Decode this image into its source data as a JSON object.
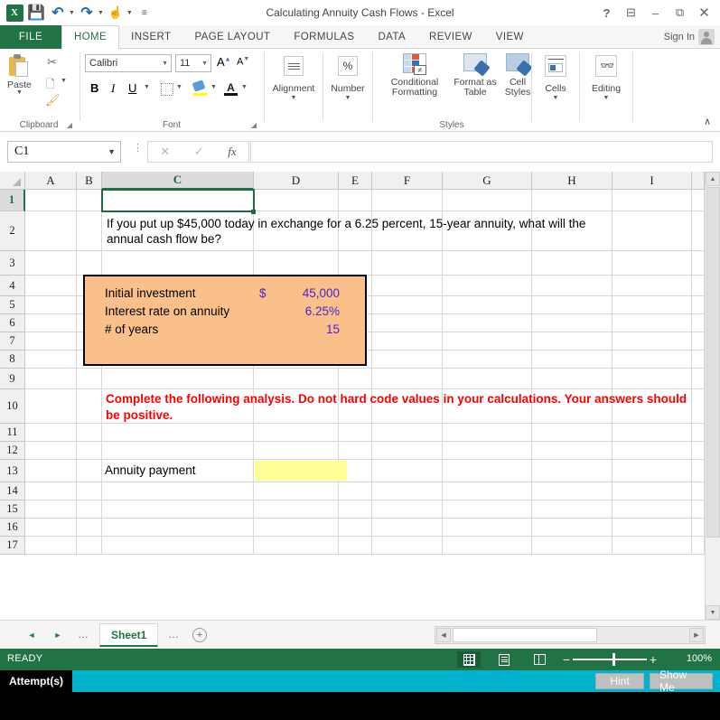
{
  "window": {
    "title": "Calculating Annuity Cash Flows - Excel",
    "controls": [
      "?",
      "ribbon-display",
      "minimize",
      "restore",
      "close"
    ],
    "sign_in": "Sign In"
  },
  "quick_access": [
    {
      "name": "excel-logo",
      "glyph": "X"
    },
    {
      "name": "save-icon",
      "glyph": "❐"
    },
    {
      "name": "undo-icon",
      "glyph": "↶"
    },
    {
      "name": "redo-icon",
      "glyph": "↷"
    },
    {
      "name": "touch-mode-icon",
      "glyph": "☝"
    },
    {
      "name": "customize-qat-icon",
      "glyph": "≡"
    }
  ],
  "ribbon": {
    "tabs": [
      {
        "label": "FILE",
        "active": false
      },
      {
        "label": "HOME",
        "active": true
      },
      {
        "label": "INSERT",
        "active": false
      },
      {
        "label": "PAGE LAYOUT",
        "active": false
      },
      {
        "label": "FORMULAS",
        "active": false
      },
      {
        "label": "DATA",
        "active": false
      },
      {
        "label": "REVIEW",
        "active": false
      },
      {
        "label": "VIEW",
        "active": false
      }
    ],
    "groups": {
      "clipboard": {
        "label": "Clipboard",
        "paste": "Paste",
        "cut": "Cut",
        "copy": "Copy",
        "format_painter": "Format Painter"
      },
      "font": {
        "label": "Font",
        "font_name": "Calibri",
        "font_size": "11",
        "grow": "A",
        "shrink": "A",
        "bold": "B",
        "italic": "I",
        "underline": "U",
        "borders": "Borders",
        "fill_color": "Fill Color",
        "font_color": "A"
      },
      "alignment": {
        "label": "Alignment"
      },
      "number": {
        "label": "Number",
        "glyph": "%"
      },
      "styles": {
        "label": "Styles",
        "conditional_formatting": "Conditional Formatting",
        "format_as_table": "Format as Table",
        "cell_styles": "Cell Styles"
      },
      "cells": {
        "label": "Cells"
      },
      "editing": {
        "label": "Editing"
      },
      "collapse": "∧"
    }
  },
  "formula_bar": {
    "name_box": "C1",
    "cancel": "✕",
    "enter": "✓",
    "insert_function": "fx",
    "formula_value": ""
  },
  "grid": {
    "columns": [
      "A",
      "B",
      "C",
      "D",
      "E",
      "F",
      "G",
      "H",
      "I"
    ],
    "selected_column": "C",
    "rows": [
      "1",
      "2",
      "3",
      "4",
      "5",
      "6",
      "7",
      "8",
      "9",
      "10",
      "11",
      "12",
      "13",
      "14",
      "15",
      "16",
      "17"
    ],
    "selected_row": "1",
    "selected_cell": "C1",
    "content": {
      "question": "If you put up $45,000 today in exchange for a 6.25 percent, 15-year annuity, what will the\nannual cash flow be?",
      "input_box": {
        "rows": [
          {
            "label": "Initial investment",
            "currency": "$",
            "value": "45,000"
          },
          {
            "label": "Interest rate on annuity",
            "currency": "",
            "value": "6.25%"
          },
          {
            "label": "# of years",
            "currency": "",
            "value": "15"
          }
        ]
      },
      "instruction": "Complete the following analysis. Do not hard code values in your calculations. Your\nanswers should be positive.",
      "answer_label": "Annuity payment",
      "answer_value": ""
    }
  },
  "sheet_tabs": {
    "first": "◄",
    "prev": "◄",
    "next": "►",
    "last": "►",
    "ellipsis_left": "…",
    "ellipsis_right": "…",
    "tabs": [
      {
        "label": "Sheet1",
        "active": true
      }
    ],
    "add": "+"
  },
  "status_bar": {
    "state": "READY",
    "views": [
      "normal-view",
      "page-layout-view",
      "page-break-view"
    ],
    "zoom_out": "−",
    "zoom_in": "+",
    "zoom_level": "100%"
  },
  "attempt_bar": {
    "label": "Attempt(s)",
    "hint_button": "Hint",
    "show_me_button": "Show Me"
  },
  "colors": {
    "excel_green": "#217346",
    "input_box_fill": "#f9c08a",
    "input_value": "#4b22d6",
    "instruction_red": "#ff0000",
    "answer_fill": "#ffff99",
    "attempt_cyan": "#00b2cc"
  }
}
